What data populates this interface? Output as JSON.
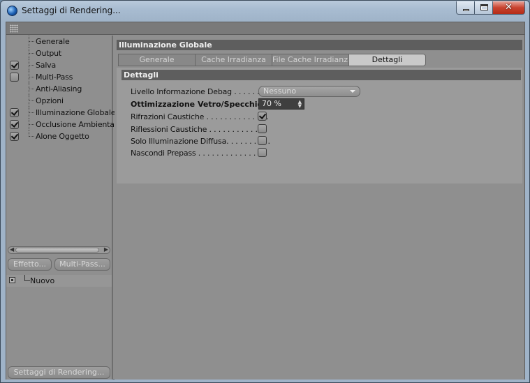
{
  "window": {
    "title": "Settaggi di Rendering...",
    "close_glyph": "✕"
  },
  "sidebar": {
    "items": [
      {
        "label": "Generale",
        "checkbox": false
      },
      {
        "label": "Output",
        "checkbox": false
      },
      {
        "label": "Salva",
        "checkbox": true,
        "checked": true
      },
      {
        "label": "Multi-Pass",
        "checkbox": true,
        "checked": false
      },
      {
        "label": "Anti-Aliasing",
        "checkbox": false
      },
      {
        "label": "Opzioni",
        "checkbox": false
      },
      {
        "label": "Illuminazione Globale",
        "checkbox": true,
        "checked": true
      },
      {
        "label": "Occlusione Ambientale",
        "checkbox": true,
        "checked": true
      },
      {
        "label": "Alone Oggetto",
        "checkbox": true,
        "checked": true
      }
    ],
    "effect_button": "Effetto...",
    "multipass_button": "Multi-Pass...",
    "preset_item": "Nuovo",
    "bottom_button": "Settaggi di Rendering..."
  },
  "main": {
    "section_title": "Illuminazione Globale",
    "tabs": [
      {
        "label": "Generale",
        "active": false
      },
      {
        "label": "Cache Irradianza",
        "active": false
      },
      {
        "label": "File Cache Irradianza",
        "active": false
      },
      {
        "label": "Dettagli",
        "active": true
      }
    ],
    "subsection_title": "Dettagli",
    "properties": {
      "debug_level_label": "Livello Informazione Debag . . . . . . . . .",
      "debug_level_value": "Nessuno",
      "glass_opt_label": "Ottimizzazione  Vetro/Specchio",
      "glass_opt_value": "70 %",
      "refr_caustics_label": "Rifrazioni Caustiche . . . . . . . . . . . . . .",
      "refr_caustics_checked": true,
      "refl_caustics_label": "Riflessioni Caustiche  . . . . . . . . . . . . .",
      "refl_caustics_checked": false,
      "diffuse_only_label": "Solo Illuminazione Diffusa. . . . . . . . . .",
      "diffuse_only_checked": false,
      "hide_prepass_label": "Nascondi Prepass  . . . . . . . . . . . . . . .",
      "hide_prepass_checked": false
    }
  }
}
